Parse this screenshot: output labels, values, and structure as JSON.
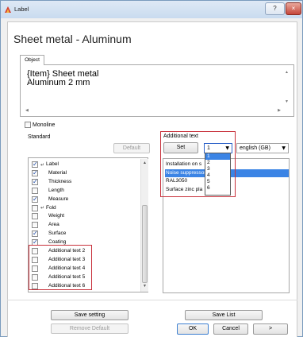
{
  "window": {
    "title": "Label",
    "help_button": "?",
    "close_button": "×"
  },
  "heading": "Sheet metal - Aluminum",
  "object_tab": {
    "label": "Object",
    "text_line1": "{Item} Sheet metal",
    "text_line2": "Aluminum 2 mm"
  },
  "monoline": {
    "label": "Monoline",
    "checked": false
  },
  "standard": {
    "label": "Standard",
    "default_button": "Default",
    "items": [
      {
        "label": "Label",
        "checked": true,
        "arrow": true
      },
      {
        "label": "Material",
        "checked": true,
        "arrow": false
      },
      {
        "label": "Thickness",
        "checked": true,
        "arrow": false
      },
      {
        "label": "Length",
        "checked": false,
        "arrow": false
      },
      {
        "label": "Measure",
        "checked": true,
        "arrow": false
      },
      {
        "label": "Fold",
        "checked": false,
        "arrow": true
      },
      {
        "label": "Weight",
        "checked": false,
        "arrow": false
      },
      {
        "label": "Area",
        "checked": false,
        "arrow": false
      },
      {
        "label": "Surface",
        "checked": true,
        "arrow": false
      },
      {
        "label": "Coating",
        "checked": true,
        "arrow": false
      },
      {
        "label": "Additional text 2",
        "checked": false,
        "arrow": false
      },
      {
        "label": "Additional text 3",
        "checked": false,
        "arrow": false
      },
      {
        "label": "Additional text 4",
        "checked": false,
        "arrow": false
      },
      {
        "label": "Additional text 5",
        "checked": false,
        "arrow": false
      },
      {
        "label": "Additional text 6",
        "checked": false,
        "arrow": false
      }
    ]
  },
  "additional": {
    "label": "Additional text",
    "set_button": "Set",
    "number_combo": {
      "value": "1",
      "options": [
        "1",
        "2",
        "3",
        "4",
        "5",
        "6"
      ],
      "highlighted": "1"
    },
    "language_combo": {
      "value": "english (GB)"
    },
    "items": [
      {
        "label": "Installation on s",
        "selected": false
      },
      {
        "label": "Noise suppressor",
        "selected": true
      },
      {
        "label": "RAL3050",
        "selected": false
      },
      {
        "label": "Surface zinc pla",
        "selected": false
      }
    ]
  },
  "buttons": {
    "save_setting": "Save setting",
    "remove_default": "Remove Default",
    "save_list": "Save List",
    "ok": "OK",
    "cancel": "Cancel",
    "next": ">"
  },
  "colors": {
    "highlight": "#3b84e5",
    "annotation_red": "#c8323c"
  }
}
